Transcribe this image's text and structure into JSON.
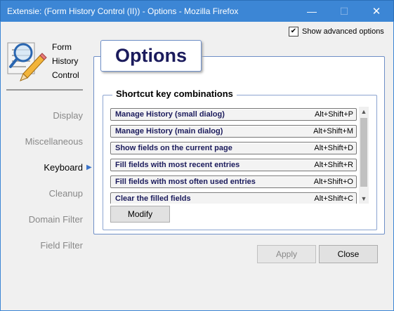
{
  "window": {
    "title": "Extensie: (Form History Control (II)) - Options - Mozilla Firefox",
    "minimize_glyph": "—",
    "maximize_glyph": "☐",
    "close_glyph": "✕"
  },
  "advanced": {
    "label": "Show advanced options",
    "checked": true,
    "check_glyph": "✔"
  },
  "logo": {
    "line1": "Form",
    "line2": "History",
    "line3": "Control"
  },
  "nav": {
    "items": [
      {
        "label": "Display"
      },
      {
        "label": "Miscellaneous"
      },
      {
        "label": "Keyboard",
        "active": true
      },
      {
        "label": "Cleanup"
      },
      {
        "label": "Domain Filter"
      },
      {
        "label": "Field Filter"
      }
    ],
    "active_arrow": "▶"
  },
  "main": {
    "tab_title": "Options",
    "group_title": "Shortcut key combinations",
    "shortcuts": [
      {
        "label": "Manage History (small dialog)",
        "key": "Alt+Shift+P"
      },
      {
        "label": "Manage History (main dialog)",
        "key": "Alt+Shift+M"
      },
      {
        "label": "Show fields on the current page",
        "key": "Alt+Shift+D"
      },
      {
        "label": "Fill fields with most recent entries",
        "key": "Alt+Shift+R"
      },
      {
        "label": "Fill fields with most often used entries",
        "key": "Alt+Shift+O"
      },
      {
        "label": "Clear the filled fields",
        "key": "Alt+Shift+C"
      }
    ],
    "modify_label": "Modify",
    "scroll_up_glyph": "▲",
    "scroll_down_glyph": "▼"
  },
  "footer": {
    "apply_label": "Apply",
    "apply_disabled": true,
    "close_label": "Close"
  }
}
